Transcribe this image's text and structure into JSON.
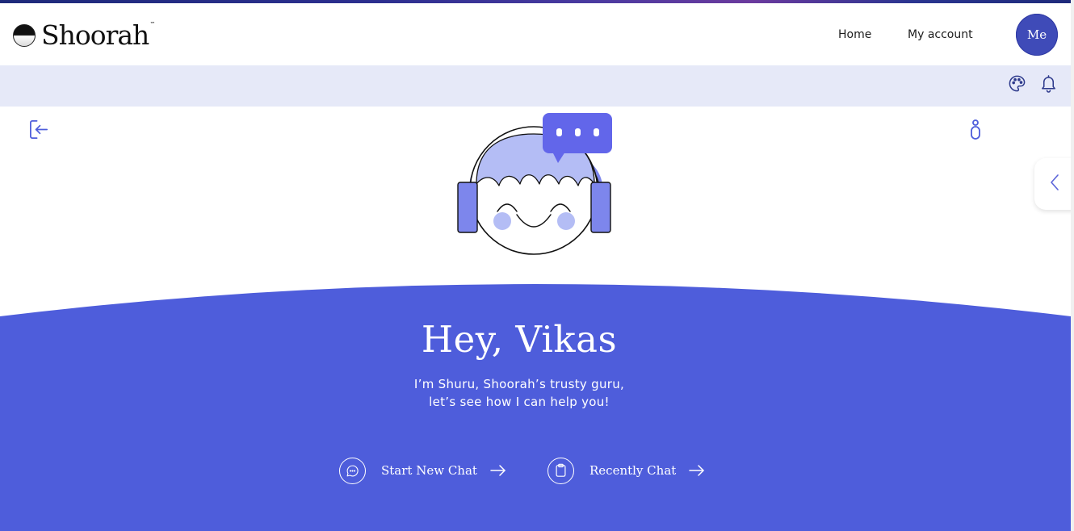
{
  "brand": {
    "name": "Shoorah",
    "trademark": "™"
  },
  "nav": {
    "home": "Home",
    "account": "My account"
  },
  "user": {
    "avatar_label": "Me"
  },
  "hero": {
    "greeting": "Hey, Vikas",
    "intro_line1": "I’m Shuru, Shoorah’s trusty guru,",
    "intro_line2": "let’s see how I can help you!"
  },
  "actions": {
    "start_new_chat": "Start New Chat",
    "recently_chat": "Recently Chat"
  },
  "icons": {
    "theme": "palette-icon",
    "notifications": "bell-icon",
    "exit": "exit-icon",
    "person": "person-icon",
    "collapse": "chevron-left-icon",
    "chat": "chat-bubble-icon",
    "clipboard": "clipboard-icon",
    "arrow": "arrow-right-icon"
  },
  "colors": {
    "primary": "#4e5ddb",
    "subbar": "#e6e9f8",
    "mascot_light": "#b4bdf5",
    "mascot_mid": "#7d86ec",
    "bubble": "#6266ea"
  }
}
